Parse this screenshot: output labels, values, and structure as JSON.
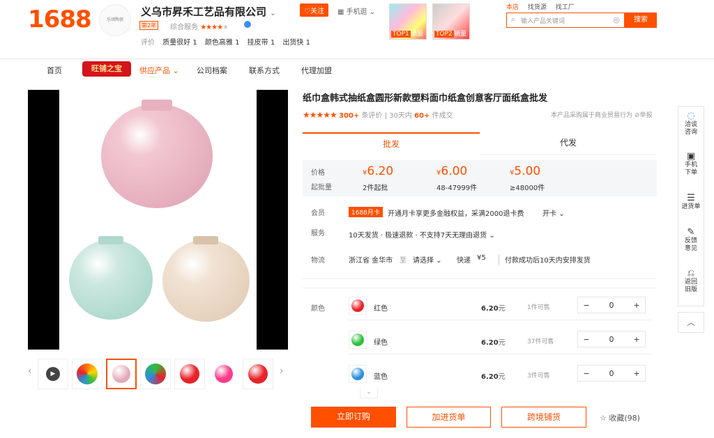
{
  "header": {
    "logo": "1688",
    "shop_logo_text": "乐颂陶瓷",
    "shop_name": "义乌市昇禾工艺品有限公司",
    "follow_label": "关注",
    "mobile_label": "手机逛",
    "year_badge": "第2年",
    "service_label": "综合服务",
    "service_stars": "★★★★",
    "service_star_empty": "★",
    "eval_label": "评价",
    "eval_tags": [
      "质量很好 1",
      "颜色高雅 1",
      "挂皮带 1",
      "出货快 1"
    ],
    "top1_label": "TOP1",
    "top1_suffix": "销量",
    "top2_label": "TOP2",
    "top2_suffix": "销量",
    "search_tabs": [
      "本店",
      "找货源",
      "找工厂"
    ],
    "search_placeholder": "输入产品关键词",
    "search_button": "搜索"
  },
  "nav": {
    "items": [
      "首页",
      "旺铺之宝",
      "供应产品",
      "公司档案",
      "联系方式",
      "代理加盟"
    ]
  },
  "product": {
    "title": "纸巾盒韩式抽纸盒圆形新款塑料面巾纸盒创意客厅面纸盒批发",
    "stars": "★★★★★",
    "review_count": "300+",
    "review_suffix": "条评价",
    "sales_prefix": "30天内",
    "sales_count": "60+",
    "sales_suffix": "件成交",
    "notice": "本产品采购属于商业贸易行为",
    "report": "举报",
    "tab_wholesale": "批发",
    "tab_dropship": "代发",
    "price_label": "价格",
    "moq_label": "起批量",
    "tiers": [
      {
        "currency": "¥",
        "price": "6.20",
        "qty": "2件起批"
      },
      {
        "currency": "¥",
        "price": "6.00",
        "qty": "48-47999件"
      },
      {
        "currency": "¥",
        "price": "5.00",
        "qty": "≥48000件"
      }
    ],
    "member_label": "会员",
    "member_badge": "1688月卡",
    "member_text": "开通月卡享更多金融权益，采满2000退卡费",
    "member_action": "开卡",
    "service_label": "服务",
    "service_text": "10天发货 · 极速退款 · 不支持7天无理由退货",
    "logistics_label": "物流",
    "origin": "浙江省 金华市",
    "to": "至",
    "dest": "请选择",
    "express": "快递",
    "express_fee": "¥5",
    "ship_note": "付款成功后10天内安排发货",
    "color_label": "颜色",
    "colors": [
      {
        "name": "红色",
        "price": "6.20",
        "unit": "元",
        "stock": "1件可售",
        "qty": "0",
        "swatch": "#e8222a"
      },
      {
        "name": "绿色",
        "price": "6.20",
        "unit": "元",
        "stock": "37件可售",
        "qty": "0",
        "swatch": "#2ec03a"
      },
      {
        "name": "蓝色",
        "price": "6.20",
        "unit": "元",
        "stock": "3件可售",
        "qty": "0",
        "swatch": "#2a8ee0"
      }
    ],
    "buy_now": "立即订购",
    "add_cart": "加进货单",
    "cross_border": "跨境铺货",
    "favorite": "收藏(98)"
  },
  "sidebar": {
    "items": [
      "洽谈咨询",
      "手机下单",
      "进货单",
      "反馈意见",
      "返回旧版"
    ]
  },
  "colors": {
    "accent": "#ff5000",
    "brand_red": "#d4141b"
  }
}
